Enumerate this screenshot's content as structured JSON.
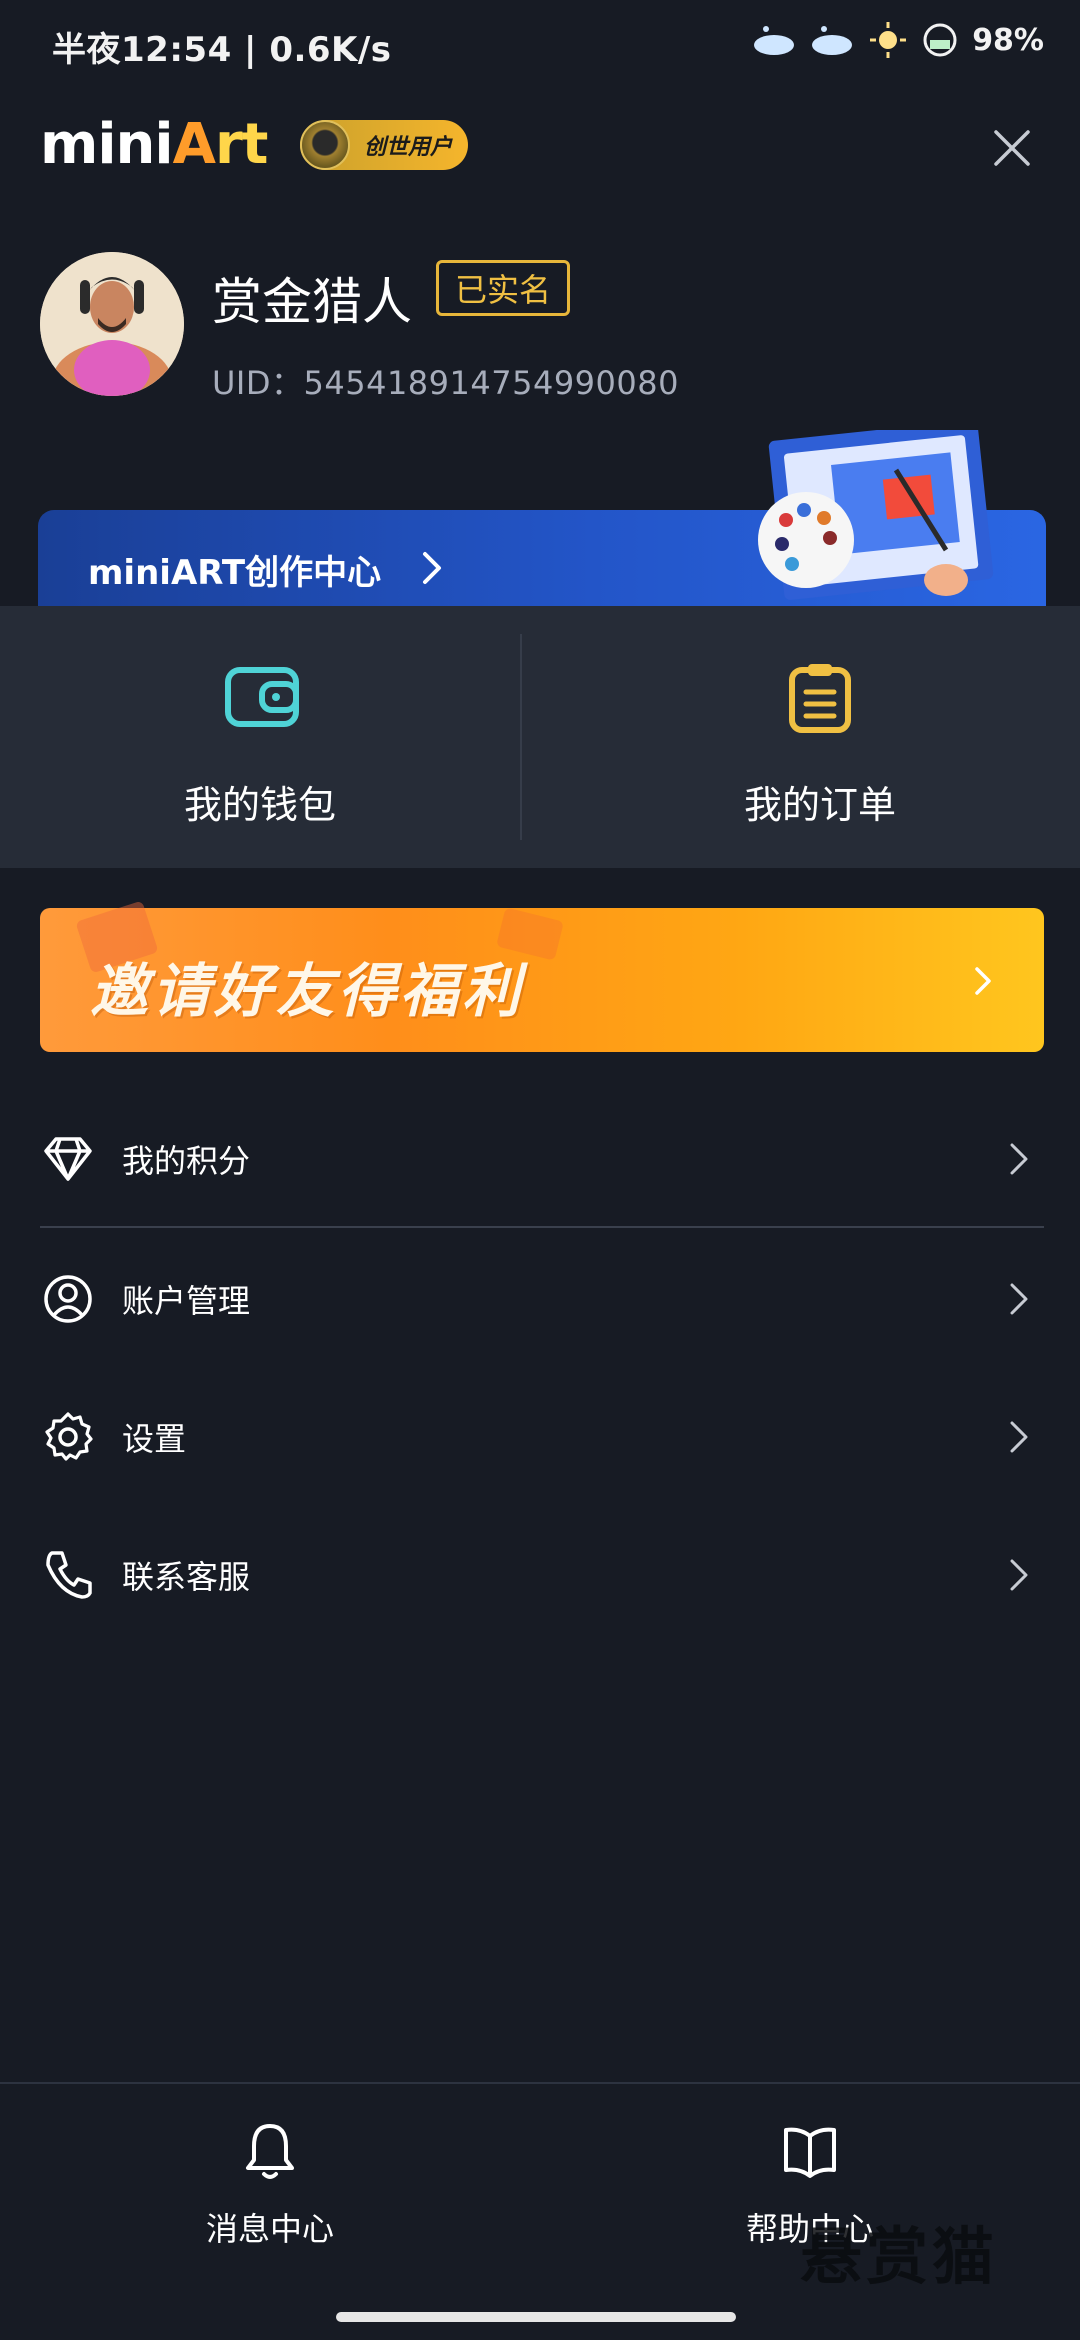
{
  "status_bar": {
    "time": "半夜12:54 | 0.6K/s",
    "battery": "98%"
  },
  "header": {
    "logo_mini": "mini",
    "logo_a": "A",
    "logo_rt": "rt",
    "badge_label": "创世用户"
  },
  "profile": {
    "username": "赏金猎人",
    "verified_label": "已实名",
    "uid": "UID：545418914754990080"
  },
  "creation_banner": {
    "label": "miniART创作中心"
  },
  "quick_actions": {
    "wallet_label": "我的钱包",
    "orders_label": "我的订单"
  },
  "invite_banner": {
    "label": "邀请好友得福利"
  },
  "menu": {
    "items": [
      {
        "label": "我的积分",
        "icon": "diamond-icon"
      },
      {
        "label": "账户管理",
        "icon": "account-icon"
      },
      {
        "label": "设置",
        "icon": "gear-icon"
      },
      {
        "label": "联系客服",
        "icon": "phone-icon"
      }
    ]
  },
  "bottom_nav": {
    "messages_label": "消息中心",
    "help_label": "帮助中心"
  },
  "watermark": "悬赏猫",
  "colors": {
    "background": "#171b24",
    "panel": "#262c37",
    "accent_yellow": "#f0c043",
    "wallet_teal": "#4fd3d6",
    "invite_orange": "#ff9a3b",
    "creation_blue": "#2355c8"
  }
}
